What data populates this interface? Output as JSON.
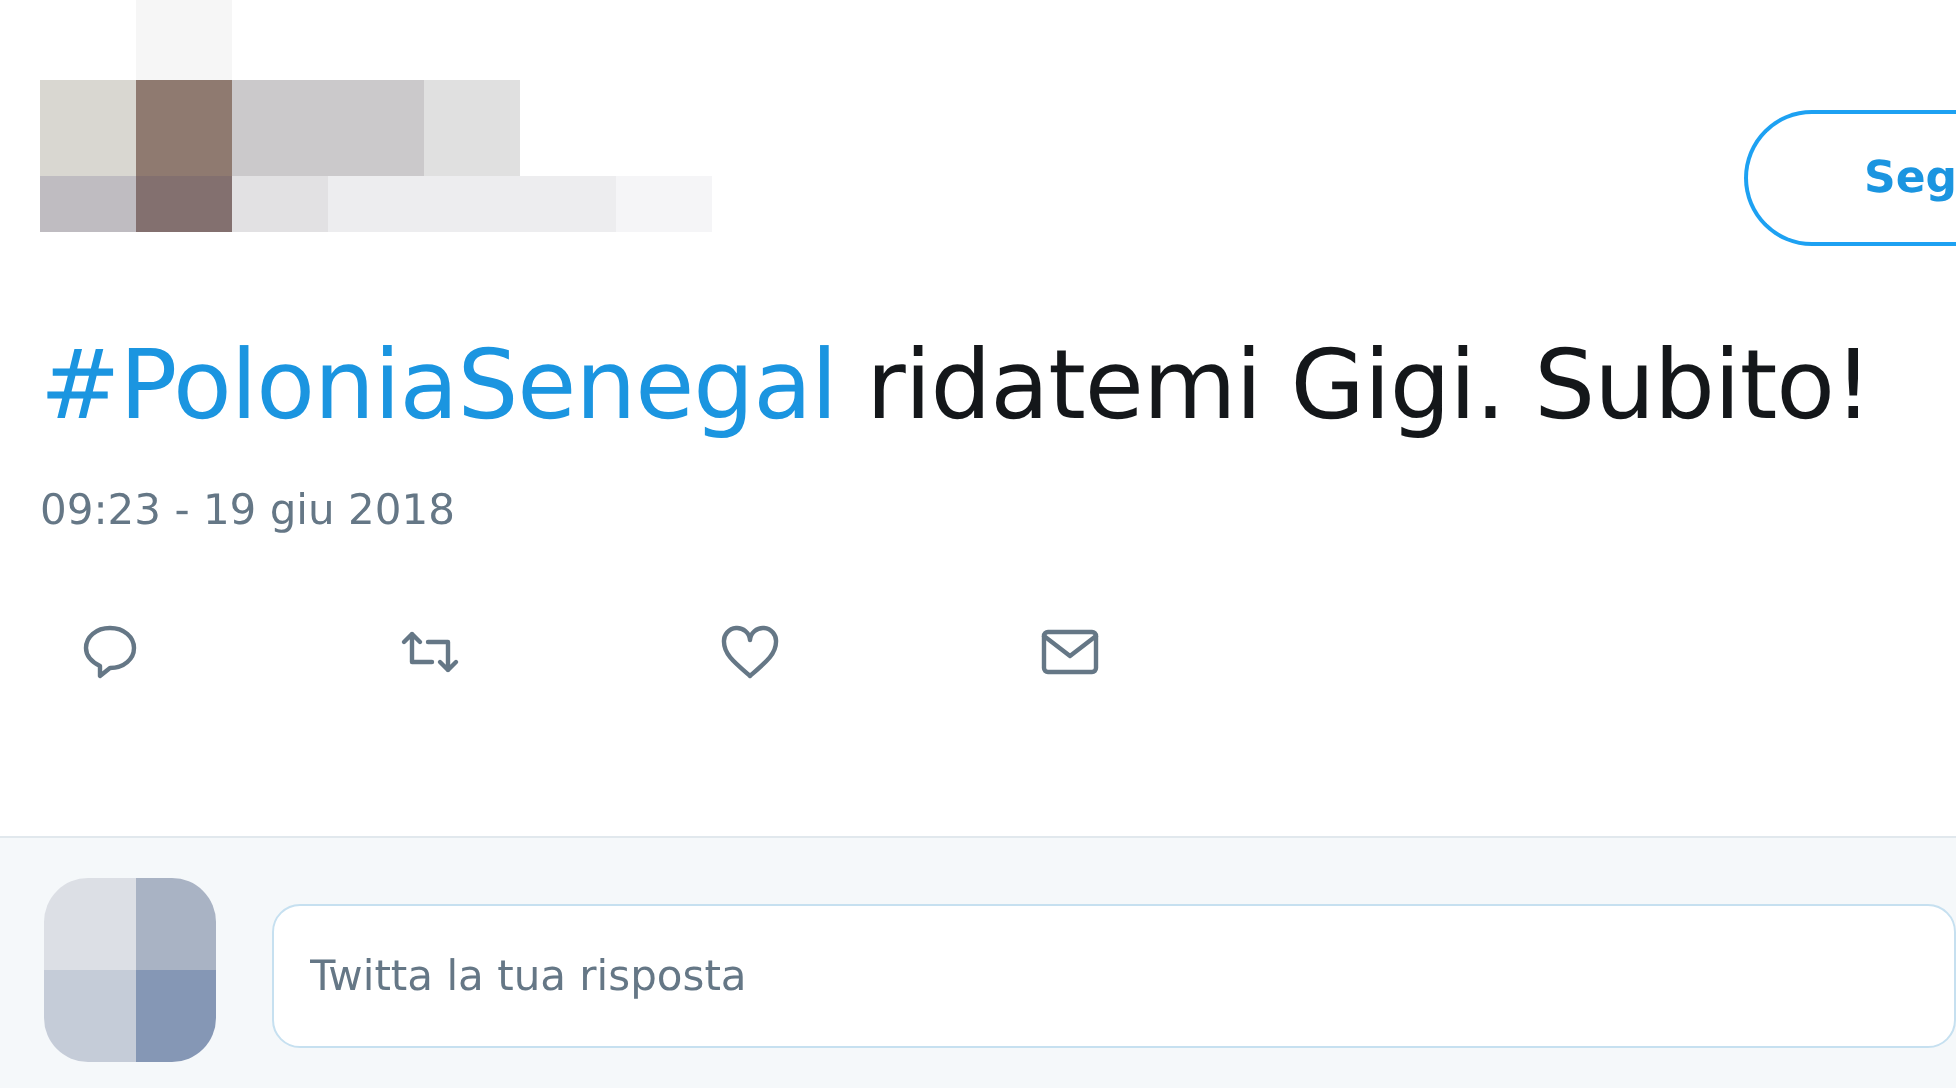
{
  "header": {
    "follow_button": "Seg"
  },
  "tweet": {
    "hashtag": "#PoloniaSenegal",
    "text": "ridatemi Gigi. Subito!",
    "timestamp": "09:23 - 19 giu 2018"
  },
  "reply": {
    "placeholder": "Twitta la tua risposta"
  }
}
